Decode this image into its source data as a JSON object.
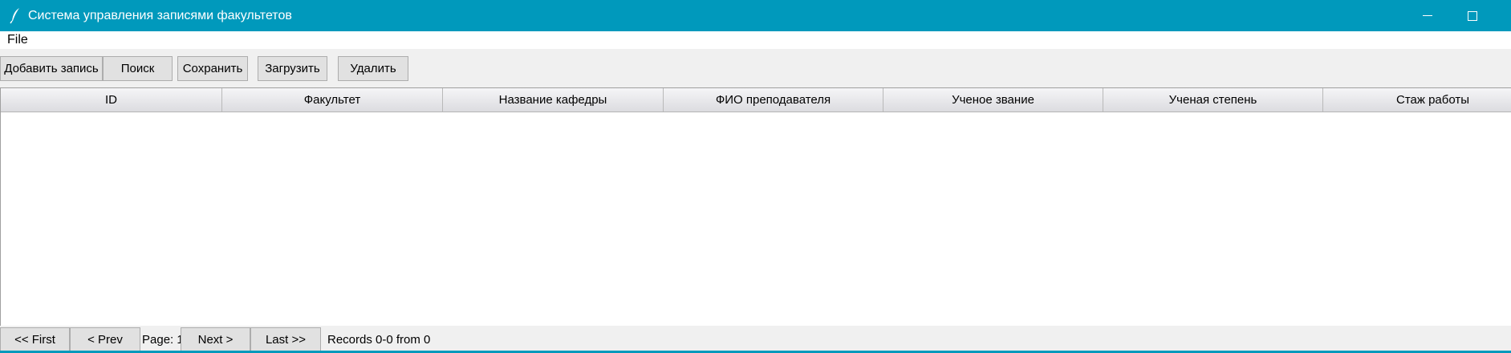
{
  "window": {
    "title": "Система управления записями факультетов",
    "app_icon": "feather-icon",
    "controls": {
      "minimize_icon": "minimize-icon",
      "maximize_icon": "maximize-icon"
    },
    "accent_color": "#0099bc"
  },
  "menubar": {
    "items": [
      {
        "label": "File"
      }
    ]
  },
  "toolbar": {
    "buttons": [
      {
        "label": "Добавить запись"
      },
      {
        "label": "Поиск"
      },
      {
        "label": "Сохранить"
      },
      {
        "label": "Загрузить"
      },
      {
        "label": "Удалить"
      }
    ]
  },
  "table": {
    "columns": [
      "ID",
      "Факультет",
      "Название кафедры",
      "ФИО преподавателя",
      "Ученое звание",
      "Ученая степень",
      "Стаж работы"
    ],
    "rows": []
  },
  "pagination": {
    "first_label": "<< First",
    "prev_label": "< Prev",
    "page_label": "Page: 1",
    "next_label": "Next >",
    "last_label": "Last >>",
    "records_label": "Records 0-0 from 0"
  }
}
